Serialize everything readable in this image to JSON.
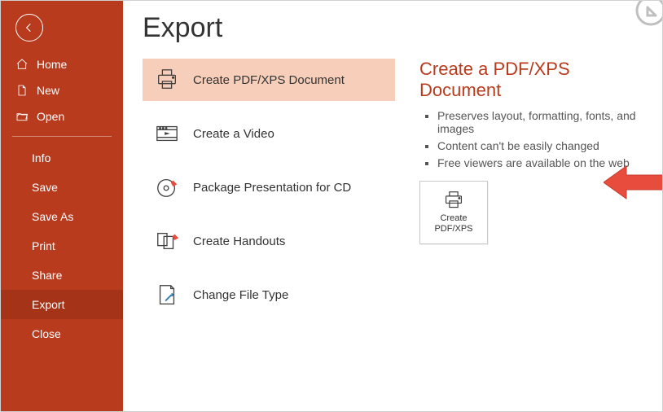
{
  "sidebar": {
    "nav": [
      {
        "label": "Home"
      },
      {
        "label": "New"
      },
      {
        "label": "Open"
      }
    ],
    "sub": [
      {
        "label": "Info"
      },
      {
        "label": "Save"
      },
      {
        "label": "Save As"
      },
      {
        "label": "Print"
      },
      {
        "label": "Share"
      },
      {
        "label": "Export"
      },
      {
        "label": "Close"
      }
    ],
    "active_sub_index": 5
  },
  "main": {
    "title": "Export",
    "options": [
      {
        "label": "Create PDF/XPS Document",
        "selected": true
      },
      {
        "label": "Create a Video"
      },
      {
        "label": "Package Presentation for CD"
      },
      {
        "label": "Create Handouts"
      },
      {
        "label": "Change File Type"
      }
    ],
    "detail": {
      "title": "Create a PDF/XPS Document",
      "bullets": [
        "Preserves layout, formatting, fonts, and images",
        "Content can't be easily changed",
        "Free viewers are available on the web"
      ],
      "action_label": "Create PDF/XPS"
    }
  },
  "colors": {
    "accent": "#b83b1d",
    "selection": "#f7ceb9",
    "arrow": "#e84c3d"
  }
}
